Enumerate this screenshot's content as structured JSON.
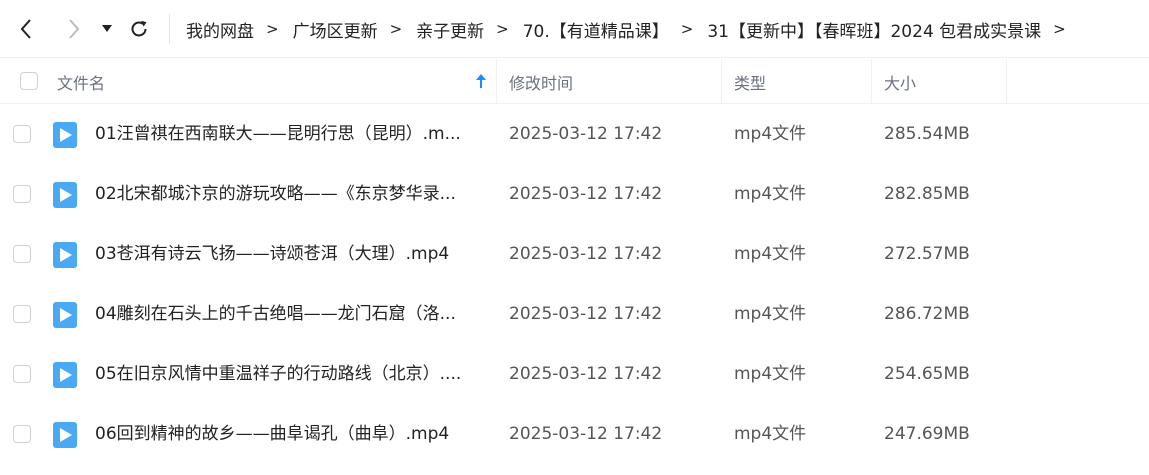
{
  "toolbar": {
    "back_icon": "chevron-left-icon",
    "forward_icon": "chevron-right-icon",
    "history_icon": "caret-down-icon",
    "refresh_icon": "refresh-icon"
  },
  "breadcrumb": [
    "我的网盘",
    "广场区更新",
    "亲子更新",
    "70.【有道精品课】",
    "31【更新中】【春晖班】2024 包君成实景课"
  ],
  "header": {
    "name": "文件名",
    "modified": "修改时间",
    "type": "类型",
    "size": "大小"
  },
  "files": [
    {
      "name": "01汪曾祺在西南联大——昆明行思（昆明）.m...",
      "modified": "2025-03-12 17:42",
      "type": "mp4文件",
      "size": "285.54MB"
    },
    {
      "name": "02北宋都城汴京的游玩攻略——《东京梦华录...",
      "modified": "2025-03-12 17:42",
      "type": "mp4文件",
      "size": "282.85MB"
    },
    {
      "name": "03苍洱有诗云飞扬——诗颂苍洱（大理）.mp4",
      "modified": "2025-03-12 17:42",
      "type": "mp4文件",
      "size": "272.57MB"
    },
    {
      "name": "04雕刻在石头上的千古绝唱——龙门石窟（洛...",
      "modified": "2025-03-12 17:42",
      "type": "mp4文件",
      "size": "286.72MB"
    },
    {
      "name": "05在旧京风情中重温祥子的行动路线（北京）....",
      "modified": "2025-03-12 17:42",
      "type": "mp4文件",
      "size": "254.65MB"
    },
    {
      "name": "06回到精神的故乡——曲阜谒孔（曲阜）.mp4",
      "modified": "2025-03-12 17:42",
      "type": "mp4文件",
      "size": "247.69MB"
    }
  ],
  "colors": {
    "accent": "#1a8cff",
    "video_icon": "#4aa9f5"
  }
}
